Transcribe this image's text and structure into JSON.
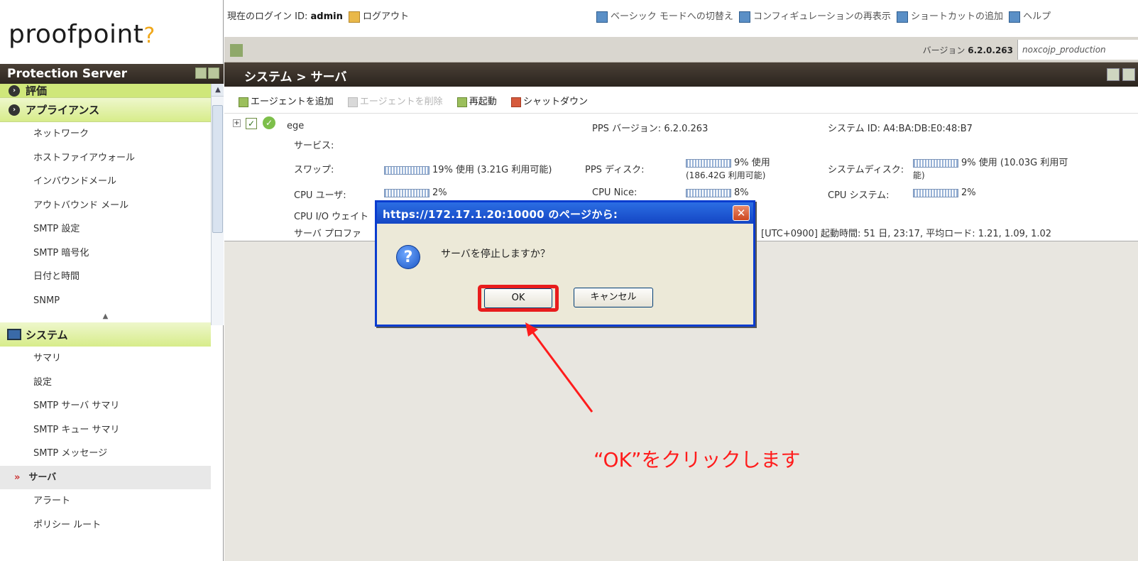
{
  "brand": {
    "logo_text": "proofpoint",
    "logo_mark": "?"
  },
  "sidebar": {
    "title": "Protection Server",
    "partial_section": "評価",
    "appliance_header": "アプライアンス",
    "appliance_items": [
      "ネットワーク",
      "ホストファイアウォール",
      "インバウンドメール",
      "アウトバウンド メール",
      "SMTP 設定",
      "SMTP 暗号化",
      "日付と時間",
      "SNMP"
    ],
    "system_header": "システム",
    "system_items": [
      "サマリ",
      "設定",
      "SMTP サーバ サマリ",
      "SMTP キュー サマリ",
      "SMTP メッセージ"
    ],
    "active_item": "サーバ",
    "after_items": [
      "アラート",
      "ポリシー ルート"
    ]
  },
  "topbar": {
    "login_prefix": "現在のログイン ID:",
    "login_user": "admin",
    "logout": "ログアウト",
    "link_basic": "ベーシック モードへの切替え",
    "link_reload": "コンフィギュレーションの再表示",
    "link_shortcut": "ショートカットの追加",
    "link_help": "ヘルプ",
    "version_label": "バージョン",
    "version_value": "6.2.0.263",
    "instance": "noxcojp_production"
  },
  "page": {
    "title": "システム > サーバ",
    "toolbar": {
      "add_agent": "エージェントを追加",
      "remove_agent": "エージェントを削除",
      "restart": "再起動",
      "shutdown": "シャットダウン"
    },
    "server": {
      "name": "ege",
      "pps_version": "PPS バージョン: 6.2.0.263",
      "system_id": "システム ID: A4:BA:DB:E0:48:B7",
      "services_label": "サービス:",
      "swap_label": "スワップ:",
      "swap_value": "19% 使用 (3.21G 利用可能)",
      "pps_disk_label": "PPS ディスク:",
      "pps_disk_value": "9% 使用",
      "pps_disk_avail": "(186.42G 利用可能)",
      "sys_disk_label": "システムディスク:",
      "sys_disk_value": "9% 使用 (10.03G 利用可",
      "sys_disk_value2": "能)",
      "cpu_user_label": "CPU ユーザ:",
      "cpu_user_value": "2%",
      "cpu_nice_label": "CPU Nice:",
      "cpu_nice_value": "8%",
      "cpu_sys_label": "CPU システム:",
      "cpu_sys_value": "2%",
      "cpu_io_label": "CPU I/O ウェイト",
      "profile_label": "サーバ プロファ",
      "uptime": "[UTC+0900]  起動時間: 51 日, 23:17, 平均ロード: 1.21, 1.09, 1.02"
    }
  },
  "dialog": {
    "title": "https://172.17.1.20:10000 のページから:",
    "message": "サーバを停止しますか？",
    "ok_label": "OK",
    "cancel_label": "キャンセル",
    "close_glyph": "✕"
  },
  "annotation": {
    "text": "“OK”をクリックします",
    "color": "#ff1c1c"
  }
}
